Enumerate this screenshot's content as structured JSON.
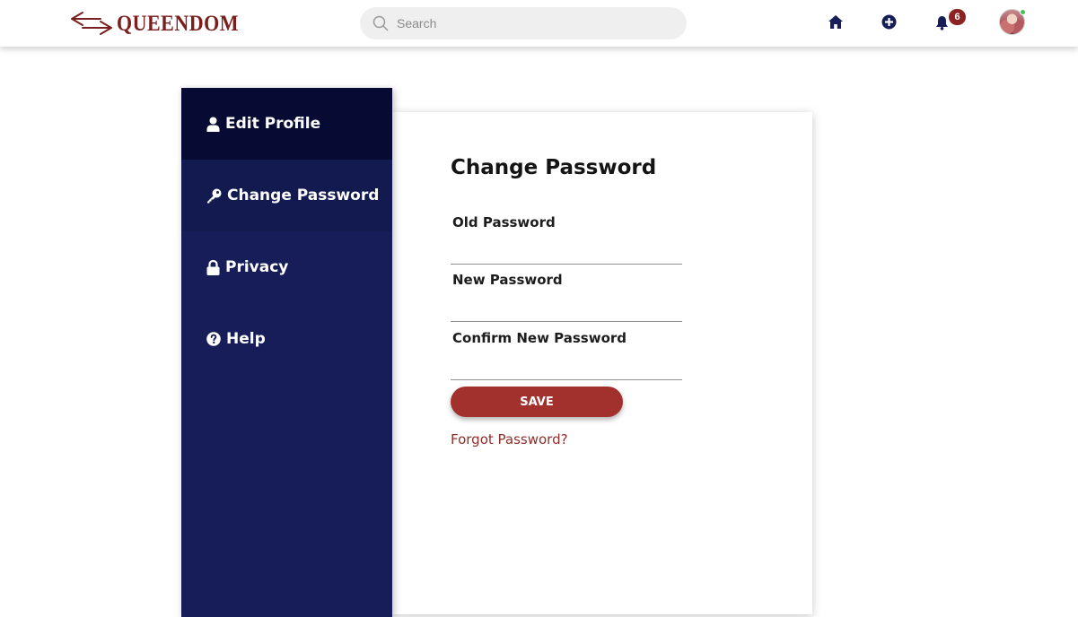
{
  "app": {
    "brand": "QUEENDOM",
    "colors": {
      "brand": "#7a1e1e",
      "nav": "#161d58",
      "accent": "#a2312d"
    }
  },
  "header": {
    "search_placeholder": "Search",
    "icons": [
      "home-icon",
      "plus-circle-icon",
      "bell-icon",
      "avatar"
    ],
    "notification_count": "6"
  },
  "sidebar": {
    "items": [
      {
        "label": "Edit Profile",
        "icon": "user-icon"
      },
      {
        "label": "Change Password",
        "icon": "key-icon"
      },
      {
        "label": "Privacy",
        "icon": "lock-icon"
      },
      {
        "label": "Help",
        "icon": "question-circle-icon"
      }
    ]
  },
  "form": {
    "title": "Change Password",
    "old_password_label": "Old Password",
    "new_password_label": "New Password",
    "confirm_password_label": "Confirm New Password",
    "save_label": "SAVE",
    "forgot_label": "Forgot Password?"
  }
}
